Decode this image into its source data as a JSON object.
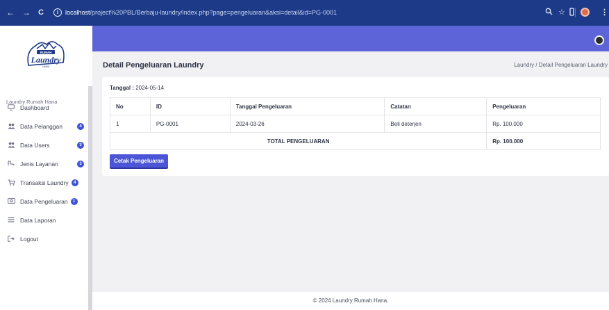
{
  "browser": {
    "back": "←",
    "forward": "→",
    "reload": "C",
    "url_host": "localhost",
    "url_path": "/project%20PBL/Berbaju-laundry/index.php?page=pengeluaran&aksi=detail&id=PG-0001"
  },
  "logo": {
    "top_text": "RUMAH",
    "main_text": "Laundry",
    "sub_text": "HANA"
  },
  "sidebar": {
    "brand": "Laundry Rumah Hana",
    "items": [
      {
        "label": "Dashboard",
        "icon": "monitor-icon",
        "badge": ""
      },
      {
        "label": "Data Pelanggan",
        "icon": "users-icon",
        "badge": "4"
      },
      {
        "label": "Data Users",
        "icon": "users-icon",
        "badge": "3"
      },
      {
        "label": "Jenis Layanan",
        "icon": "service-icon",
        "badge": "3"
      },
      {
        "label": "Transaksi Laundry",
        "icon": "cart-icon",
        "badge": "4"
      },
      {
        "label": "Data Pengeluaran",
        "icon": "money-icon",
        "badge": "1"
      },
      {
        "label": "Data Laporan",
        "icon": "list-icon",
        "badge": ""
      },
      {
        "label": "Logout",
        "icon": "logout-icon",
        "badge": ""
      }
    ]
  },
  "header": {
    "title": "Detail Pengeluaran Laundry",
    "breadcrumb": "Laundry  /  Detail Pengeluaran Laundry"
  },
  "detail": {
    "date_label": "Tanggal :",
    "date_value": "2024-05-14",
    "columns": [
      "No",
      "ID",
      "Tanggal Pengeluaran",
      "Catatan",
      "Pengeluaran"
    ],
    "rows": [
      {
        "no": "1",
        "id": "PG-0001",
        "tanggal": "2024-03-26",
        "catatan": "Beli deterjen",
        "pengeluaran": "Rp. 100.000"
      }
    ],
    "total_label": "TOTAL PENGELUARAN",
    "total_value": "Rp. 100.000",
    "print_button": "Cetak Pengeluaran"
  },
  "footer": {
    "text": "© 2024 Laundry Rumah Hana."
  },
  "colors": {
    "topbar": "#5d64d8",
    "browser_bar": "#1c3a87",
    "badge": "#3b52d8",
    "button": "#4b55d6"
  }
}
